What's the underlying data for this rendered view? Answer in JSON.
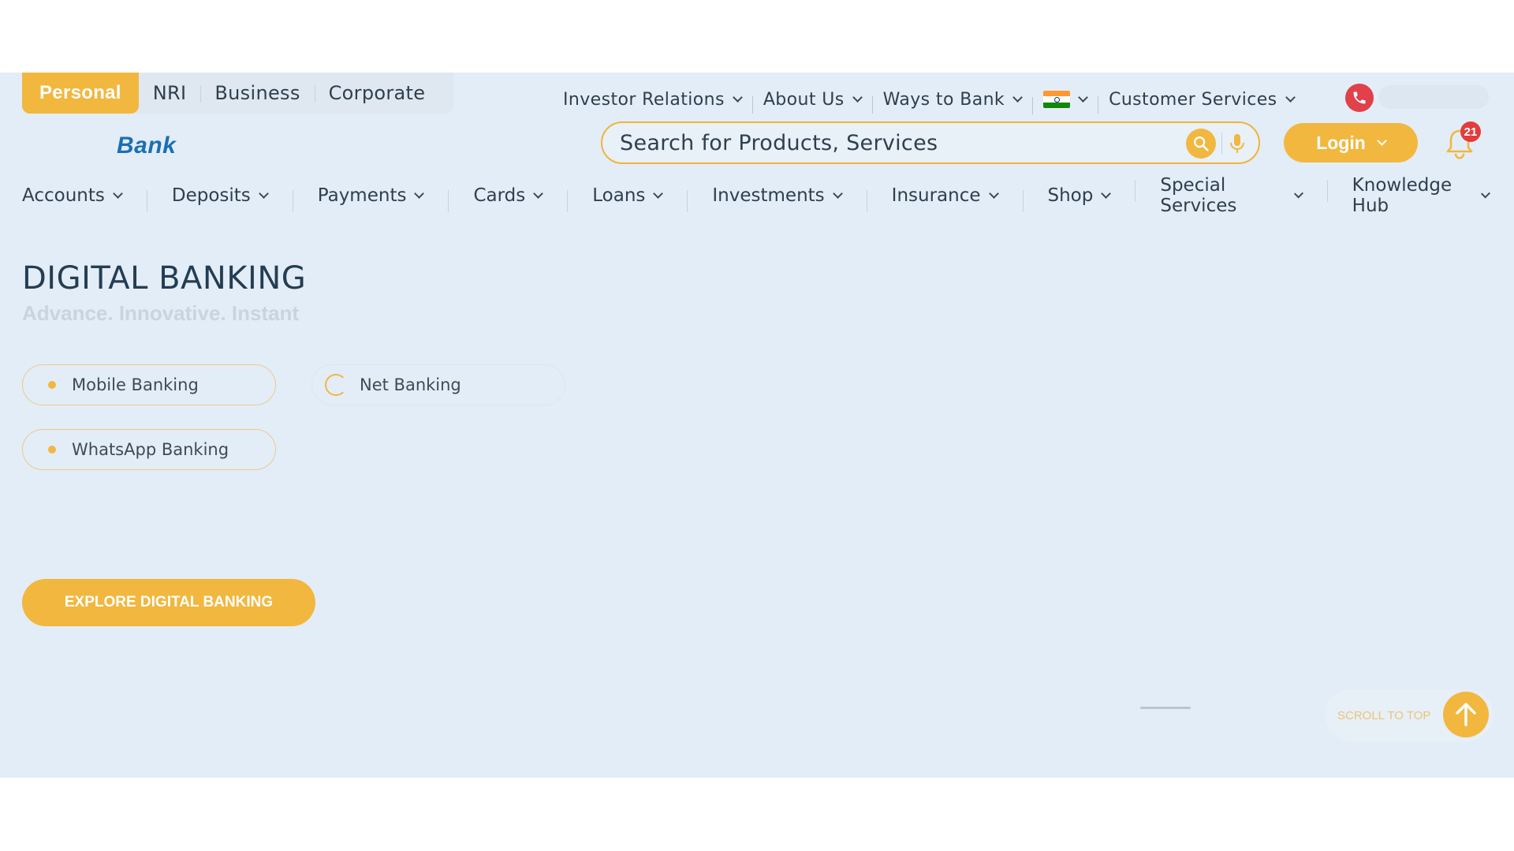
{
  "segments": [
    {
      "label": "Personal",
      "active": true
    },
    {
      "label": "NRI",
      "active": false
    },
    {
      "label": "Business",
      "active": false
    },
    {
      "label": "Corporate",
      "active": false
    }
  ],
  "utility_nav": {
    "investor_relations": "Investor Relations",
    "about_us": "About Us",
    "ways_to_bank": "Ways to Bank",
    "country_flag": "india-flag-icon",
    "customer_services": "Customer Services"
  },
  "logo": {
    "text": "Bank"
  },
  "search": {
    "placeholder": "Search for Products, Services",
    "value": ""
  },
  "login": {
    "label": "Login"
  },
  "notifications": {
    "count": "21"
  },
  "main_nav": [
    "Accounts",
    "Deposits",
    "Payments",
    "Cards",
    "Loans",
    "Investments",
    "Insurance",
    "Shop",
    "Special Services",
    "Knowledge Hub"
  ],
  "hero": {
    "title": "DIGITAL BANKING",
    "subtitle": "Advance. Innovative. Instant",
    "options": [
      {
        "label": "Mobile Banking",
        "selected": false
      },
      {
        "label": "Net Banking",
        "selected": true
      },
      {
        "label": "WhatsApp Banking",
        "selected": false
      }
    ],
    "cta": "EXPLORE DIGITAL BANKING"
  },
  "scroll_to_top": {
    "label": "SCROLL TO TOP"
  },
  "colors": {
    "accent": "#f2b73e",
    "background": "#e3edf7",
    "brand_blue": "#1b6fb2",
    "alert_red": "#e23c3c"
  }
}
